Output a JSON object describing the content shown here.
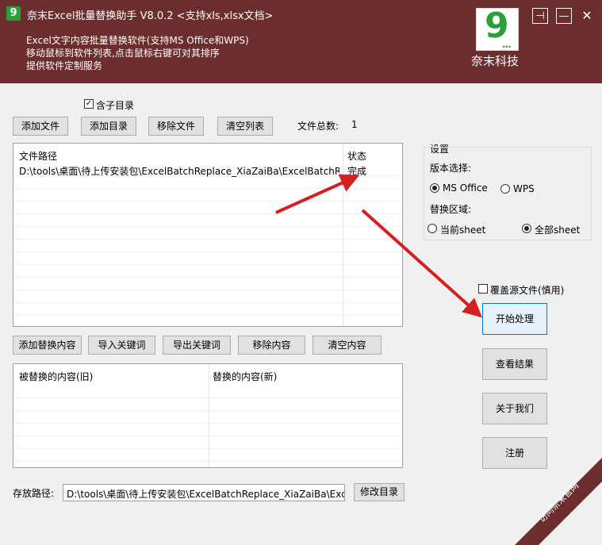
{
  "header": {
    "title": "奈末Excel批量替换助手    V8.0.2    <支持xls,xlsx文档>",
    "desc_lines": [
      "Excel文字内容批量替换软件(支持MS  Office和WPS)",
      "移动鼠标到软件列表,点击鼠标右键可对其排序",
      "提供软件定制服务"
    ],
    "brand": "奈末科技",
    "logo_digit": "9",
    "logo_dots": "...",
    "pin_glyph": "⊣",
    "min_glyph": "—",
    "close_glyph": "✕"
  },
  "files": {
    "include_subdir_label": "含子目录",
    "add_file": "添加文件",
    "add_dir": "添加目录",
    "remove_file": "移除文件",
    "clear_list": "清空列表",
    "total_label": "文件总数:",
    "total_value": "1",
    "col_path": "文件路径",
    "col_status": "状态",
    "rows": [
      {
        "path": "D:\\tools\\桌面\\待上传安装包\\ExcelBatchReplace_XiaZaiBa\\ExcelBatchRepl...",
        "status": "完成"
      }
    ]
  },
  "settings": {
    "title": "设置",
    "version_label": "版本选择:",
    "opt_ms": "MS Office",
    "opt_wps": "WPS",
    "area_label": "替换区域:",
    "opt_current": "当前sheet",
    "opt_all": "全部sheet",
    "overwrite_label": "覆盖源文件(慎用)"
  },
  "actions": {
    "start": "开始处理",
    "view": "查看结果",
    "about": "关于我们",
    "register": "注册"
  },
  "replace": {
    "add": "添加替换内容",
    "import": "导入关键词",
    "export": "导出关键词",
    "remove": "移除内容",
    "clear": "清空内容",
    "col_old": "被替换的内容(旧)",
    "col_new": "替换的内容(新)"
  },
  "output": {
    "label": "存放路径:",
    "path": "D:\\tools\\桌面\\待上传安装包\\ExcelBatchReplace_XiaZaiBa\\ExcelBa",
    "modify": "修改目录"
  },
  "watermark": {
    "ribbon": "访问奈末官网"
  },
  "colors": {
    "header_bg": "#6b2d2d",
    "logo_green": "#2aa03a",
    "arrow_red": "#d42020"
  }
}
